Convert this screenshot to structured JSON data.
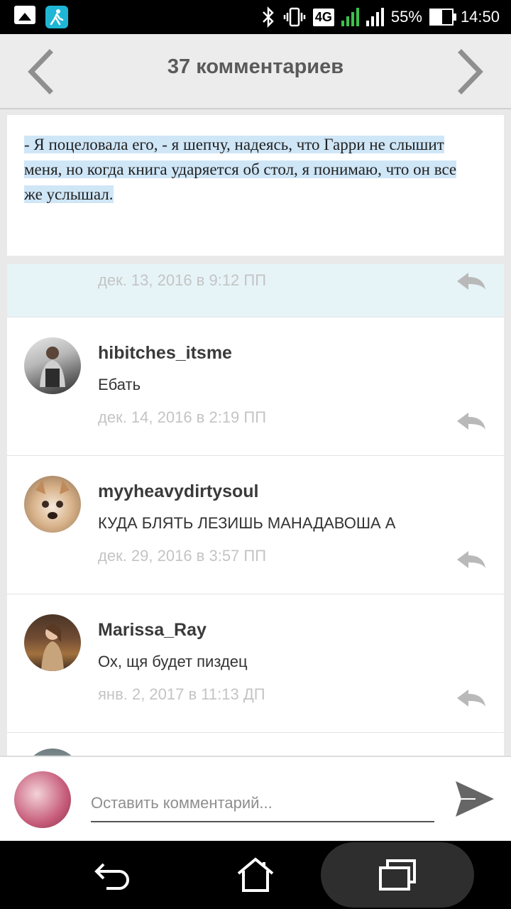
{
  "status_bar": {
    "network": "4G",
    "sim1": "1",
    "sim2": "2",
    "battery": "55%",
    "battery_level": 0.55,
    "time": "14:50"
  },
  "header": {
    "title": "37 комментариев",
    "prev_icon": "chevron-left-icon",
    "next_icon": "chevron-right-icon"
  },
  "quote": {
    "text": "- Я поцеловала его, - я шепчу, надеясь, что Гарри не слышит меня, но когда книга ударяется об стол, я понимаю, что он все же услышал."
  },
  "comments": [
    {
      "username": "",
      "text": "",
      "date": "дек. 13, 2016 в 9:12 ПП"
    },
    {
      "username": "hibitches_itsme",
      "text": "Ебать",
      "date": "дек. 14, 2016 в 2:19 ПП"
    },
    {
      "username": "myyheavydirtysoul",
      "text": "КУДА БЛЯТЬ ЛЕЗИШЬ МАНАДАВОША А",
      "date": "дек. 29, 2016 в 3:57 ПП"
    },
    {
      "username": "Marissa_Ray",
      "text": "Ох, щя будет пиздец",
      "date": "янв. 2, 2017 в 11:13 ДП"
    }
  ],
  "compose": {
    "placeholder": "Оставить комментарий..."
  },
  "colors": {
    "highlight": "#cfe6f7",
    "first_row_bg": "#e6f4f8",
    "date": "#c4c4c4",
    "header_title": "#5a5a5a"
  }
}
